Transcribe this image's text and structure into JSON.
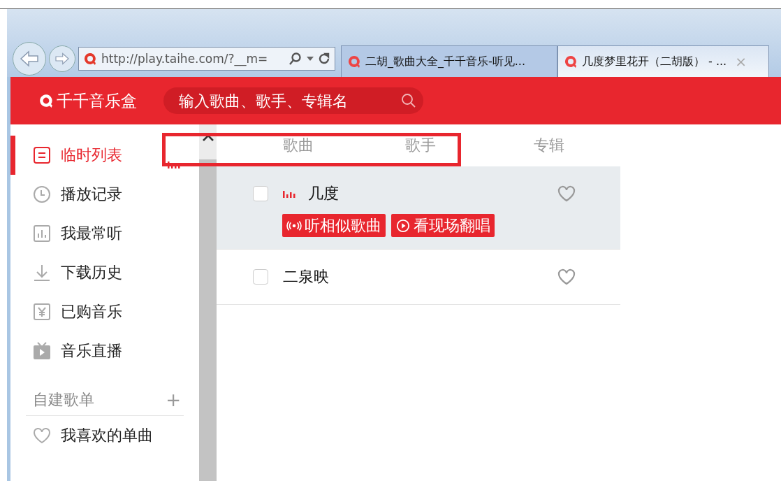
{
  "browser": {
    "url": "http://play.taihe.com/?__m=",
    "tabs": [
      {
        "title": "二胡_歌曲大全_千千音乐-听见...",
        "selected": false
      },
      {
        "title": "几度梦里花开（二胡版） - ...",
        "selected": true,
        "close": "×"
      }
    ]
  },
  "header": {
    "logo": "千千音乐盒",
    "search": {
      "placeholder": "输入歌曲、歌手、专辑名"
    }
  },
  "sidebar": {
    "items": [
      {
        "kind": "list",
        "label": "临时列表",
        "selected": true,
        "playing": true
      },
      {
        "kind": "history",
        "label": "播放记录",
        "selected": false,
        "playing": false
      },
      {
        "kind": "chart",
        "label": "我最常听",
        "selected": false,
        "playing": false
      },
      {
        "kind": "download",
        "label": "下载历史",
        "selected": false,
        "playing": false
      },
      {
        "kind": "purchase",
        "label": "已购音乐",
        "selected": false,
        "playing": false
      },
      {
        "kind": "live",
        "label": "音乐直播",
        "selected": false,
        "playing": false
      }
    ],
    "section": {
      "title": "自建歌单",
      "add": "+"
    },
    "playlists": [
      {
        "kind": "heart",
        "label": "我喜欢的单曲"
      }
    ]
  },
  "table": {
    "columns": [
      "歌曲",
      "歌手",
      "专辑"
    ],
    "rows": [
      {
        "title": "几度",
        "checked": false,
        "playing": true,
        "expanded": true,
        "actions": [
          {
            "kind": "radio",
            "label": "听相似歌曲"
          },
          {
            "kind": "play",
            "label": "看现场翻唱"
          }
        ]
      },
      {
        "title": "二泉映",
        "checked": false,
        "playing": false,
        "expanded": false,
        "actions": []
      }
    ]
  }
}
